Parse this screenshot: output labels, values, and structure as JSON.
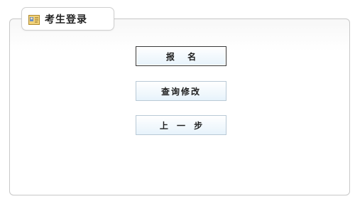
{
  "tab": {
    "title": "考生登录",
    "icon": "id-card-icon"
  },
  "buttons": {
    "register": "报  名",
    "query_modify": "查询修改",
    "previous_step": "上 一 步"
  },
  "colors": {
    "panel_border": "#c8c8c8",
    "button_border": "#b9c9d6",
    "button_fill": "#e7f3fb",
    "primary_border": "#3a3a3a"
  }
}
